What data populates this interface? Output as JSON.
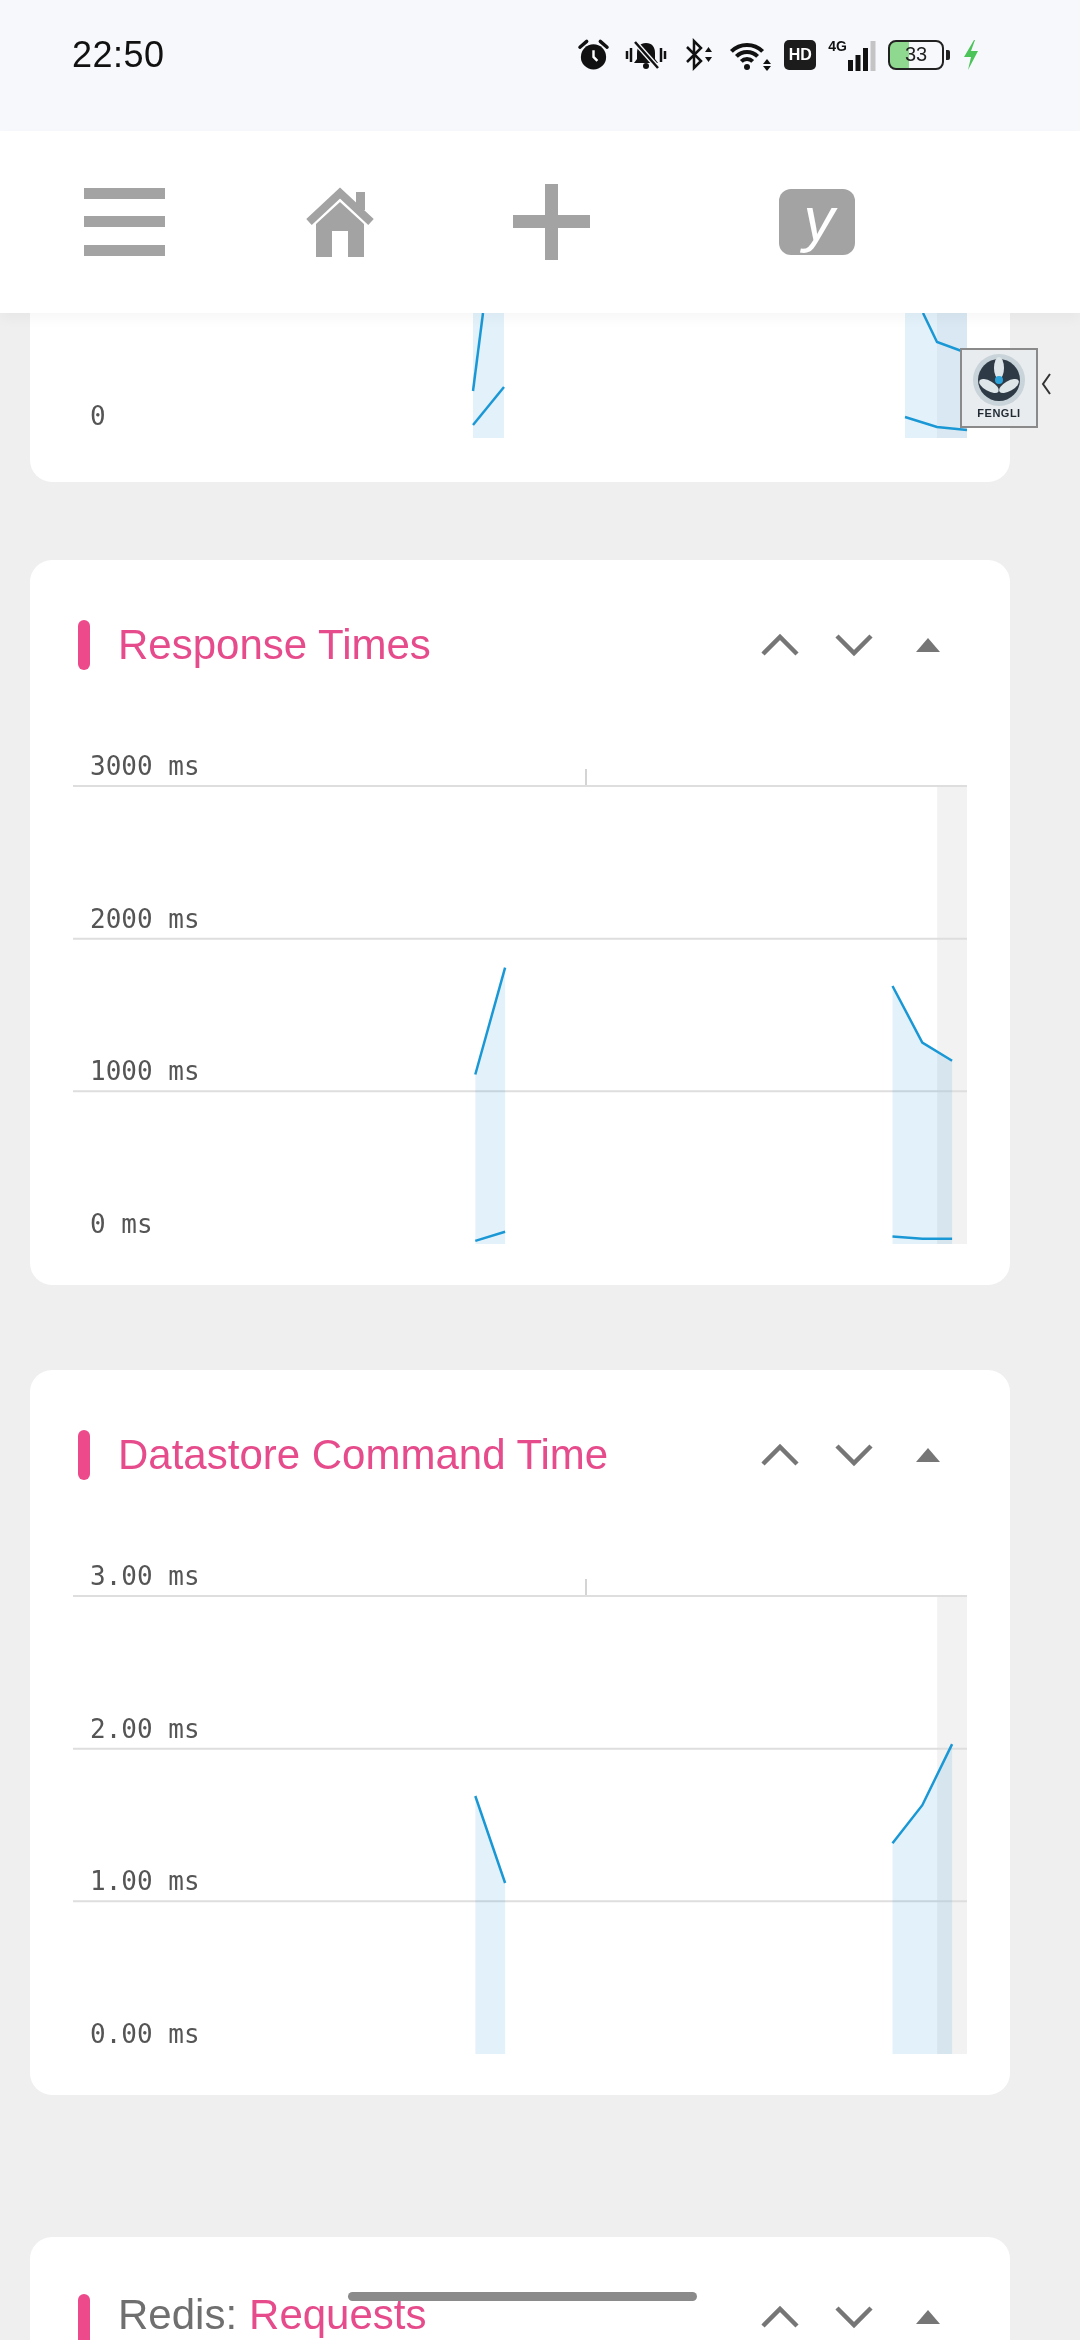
{
  "status_bar": {
    "time": "22:50",
    "hd_label": "HD",
    "network_type": "4G",
    "battery": "33",
    "charging": true
  },
  "toolbar": {
    "logo_letter": "y"
  },
  "floating_badge": {
    "label": "FENGLI"
  },
  "partial_card": {
    "axis_label": "0"
  },
  "cards": [
    {
      "title": "Response Times",
      "chart_data": {
        "type": "area",
        "categories": [
          null,
          null,
          null,
          null,
          null,
          null,
          null,
          null,
          null,
          null,
          null,
          null,
          null,
          null,
          null,
          null,
          null,
          null,
          null,
          null,
          null,
          null,
          null,
          null,
          null,
          null,
          null,
          null,
          null,
          null
        ],
        "ylim": [
          0,
          3000
        ],
        "yticks": [
          {
            "value": 0,
            "label": "0 ms"
          },
          {
            "value": 1000,
            "label": "1000 ms"
          },
          {
            "value": 2000,
            "label": "2000 ms"
          },
          {
            "value": 3000,
            "label": "3000 ms"
          }
        ],
        "series": [
          {
            "color": "#1a98d5",
            "values": [
              null,
              null,
              null,
              null,
              null,
              null,
              null,
              null,
              null,
              null,
              null,
              null,
              null,
              1110,
              1810,
              null,
              null,
              null,
              null,
              null,
              null,
              null,
              null,
              null,
              null,
              null,
              null,
              1690,
              1320,
              1200
            ]
          },
          {
            "type": "line",
            "color": "#1a98d5",
            "values": [
              null,
              null,
              null,
              null,
              null,
              null,
              null,
              null,
              null,
              null,
              null,
              null,
              null,
              20,
              80,
              null,
              null,
              null,
              null,
              null,
              null,
              null,
              null,
              null,
              null,
              null,
              null,
              50,
              35,
              35
            ]
          }
        ]
      }
    },
    {
      "title": "Datastore Command Time",
      "chart_data": {
        "type": "area",
        "categories": [
          null,
          null,
          null,
          null,
          null,
          null,
          null,
          null,
          null,
          null,
          null,
          null,
          null,
          null,
          null,
          null,
          null,
          null,
          null,
          null,
          null,
          null,
          null,
          null,
          null,
          null,
          null,
          null,
          null,
          null
        ],
        "ylim": [
          0,
          3
        ],
        "yticks": [
          {
            "value": 0,
            "label": "0.00 ms"
          },
          {
            "value": 1,
            "label": "1.00 ms"
          },
          {
            "value": 2,
            "label": "2.00 ms"
          },
          {
            "value": 3,
            "label": "3.00 ms"
          }
        ],
        "series": [
          {
            "color": "#1a98d5",
            "values": [
              null,
              null,
              null,
              null,
              null,
              null,
              null,
              null,
              null,
              null,
              null,
              null,
              null,
              1.69,
              1.12,
              null,
              null,
              null,
              null,
              null,
              null,
              null,
              null,
              null,
              null,
              null,
              null,
              1.38,
              1.63,
              2.03
            ]
          }
        ]
      }
    }
  ],
  "partial_next_card": {
    "prefix": "Redis:",
    "title": "Requests"
  }
}
